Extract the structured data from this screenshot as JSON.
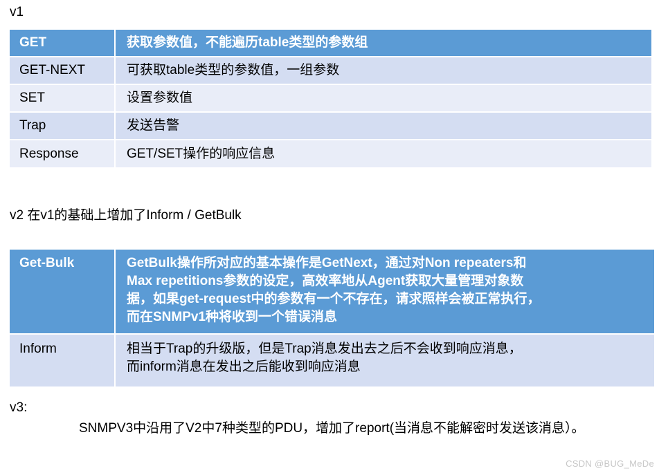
{
  "labels": {
    "v1": "v1",
    "v2": "v2 在v1的基础上增加了Inform / GetBulk",
    "v3": "v3:"
  },
  "v3_text": "SNMPV3中沿用了V2中7种类型的PDU，增加了report(当消息不能解密时发送该消息）。",
  "table_v1": {
    "rows": [
      {
        "key": "GET",
        "value": "获取参数值，不能遍历table类型的参数组",
        "style": "header"
      },
      {
        "key": "GET-NEXT",
        "value": "可获取table类型的参数值，一组参数",
        "style": "a"
      },
      {
        "key": "SET",
        "value": "设置参数值",
        "style": "b"
      },
      {
        "key": "Trap",
        "value": "发送告警",
        "style": "a"
      },
      {
        "key": "Response",
        "value": "GET/SET操作的响应信息",
        "style": "b"
      }
    ]
  },
  "table_v2": {
    "rows": [
      {
        "key": "Get-Bulk",
        "value": "GetBulk操作所对应的基本操作是GetNext，通过对Non repeaters和\nMax repetitions参数的设定，高效率地从Agent获取大量管理对象数\n据，如果get-request中的参数有一个不存在，请求照样会被正常执行，\n而在SNMPv1种将收到一个错误消息",
        "style": "header"
      },
      {
        "key": "Inform",
        "value": "相当于Trap的升级版，但是Trap消息发出去之后不会收到响应消息，\n而inform消息在发出之后能收到响应消息",
        "style": "a"
      }
    ]
  },
  "watermark": "CSDN @BUG_MeDe",
  "colors": {
    "header_blue": "#5b9bd5",
    "row_a": "#d4ddf2",
    "row_b": "#e9edf8",
    "text": "#000000",
    "header_text": "#ffffff",
    "watermark": "#c8c8c8"
  }
}
